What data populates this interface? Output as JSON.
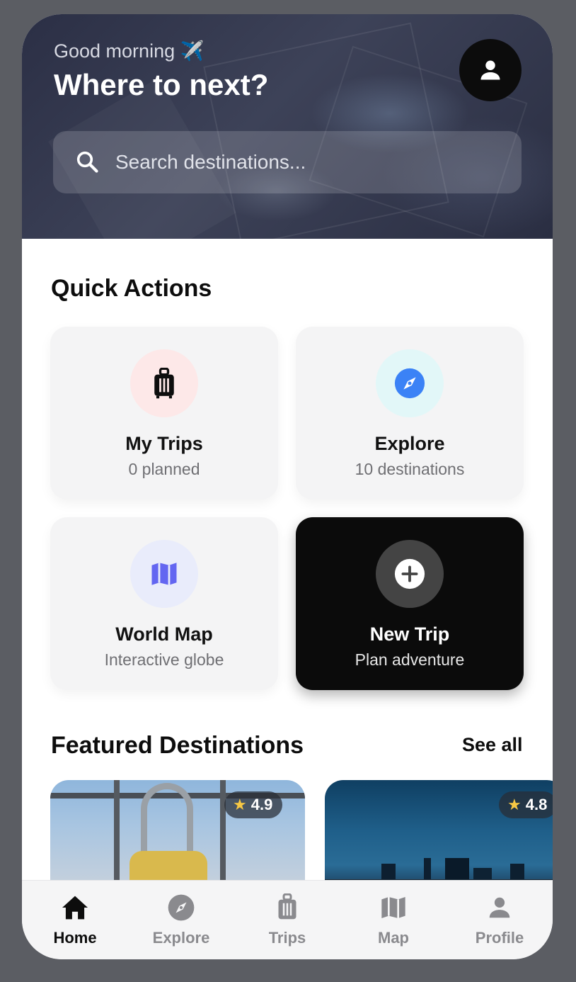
{
  "header": {
    "greeting": "Good morning ✈️",
    "title": "Where to next?",
    "profile_button": "user-icon"
  },
  "search": {
    "placeholder": "Search destinations..."
  },
  "quick_actions": {
    "title": "Quick Actions",
    "items": [
      {
        "label": "My Trips",
        "sub": "0 planned",
        "icon": "luggage-icon",
        "icon_bg": "#fde8e8",
        "icon_color": "#0d0d0d"
      },
      {
        "label": "Explore",
        "sub": "10 destinations",
        "icon": "compass-icon",
        "icon_bg": "#e2f7f8",
        "icon_color": "#3b82f6"
      },
      {
        "label": "World Map",
        "sub": "Interactive globe",
        "icon": "map-icon",
        "icon_bg": "#e9ecfb",
        "icon_color": "#6366f1"
      },
      {
        "label": "New Trip",
        "sub": "Plan adventure",
        "icon": "plus-circle-icon",
        "icon_bg": "#444444",
        "icon_color": "#ffffff"
      }
    ]
  },
  "featured": {
    "title": "Featured Destinations",
    "see_all": "See all",
    "items": [
      {
        "rating": "4.9"
      },
      {
        "rating": "4.8"
      }
    ]
  },
  "tabbar": {
    "items": [
      {
        "label": "Home",
        "icon": "home-icon",
        "active": true
      },
      {
        "label": "Explore",
        "icon": "compass-icon",
        "active": false
      },
      {
        "label": "Trips",
        "icon": "luggage-icon",
        "active": false
      },
      {
        "label": "Map",
        "icon": "map-icon",
        "active": false
      },
      {
        "label": "Profile",
        "icon": "user-icon",
        "active": false
      }
    ]
  }
}
